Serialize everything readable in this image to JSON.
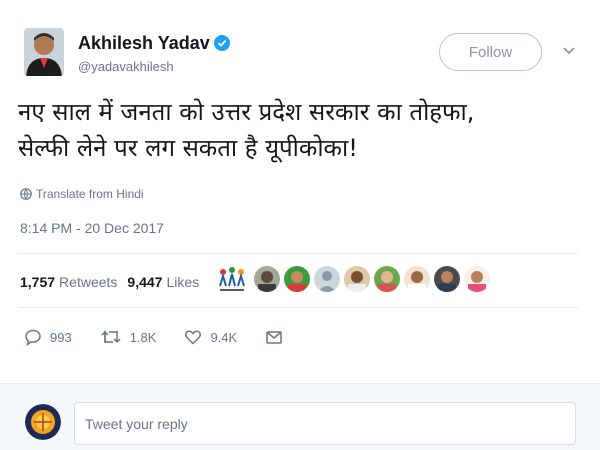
{
  "profile": {
    "name": "Akhilesh Yadav",
    "handle": "@yadavakhilesh",
    "verified": true,
    "follow_label": "Follow"
  },
  "tweet": {
    "text_line1": "नए साल में जनता को उत्तर प्रदेश सरकार का तोहफा,",
    "text_line2": "सेल्फी लेने पर लग सकता है यूपीकोका!",
    "translate_label": "Translate from Hindi",
    "timestamp": "8:14 PM - 20 Dec 2017"
  },
  "stats": {
    "retweets_count": "1,757",
    "retweets_label": "Retweets",
    "likes_count": "9,447",
    "likes_label": "Likes"
  },
  "actions": {
    "replies": "993",
    "retweets": "1.8K",
    "likes": "9.4K"
  },
  "reply": {
    "placeholder": "Tweet your reply"
  },
  "colors": {
    "text": "#14171a",
    "muted": "#657786",
    "verified": "#1da1f2",
    "divider": "#e6ecf0"
  }
}
